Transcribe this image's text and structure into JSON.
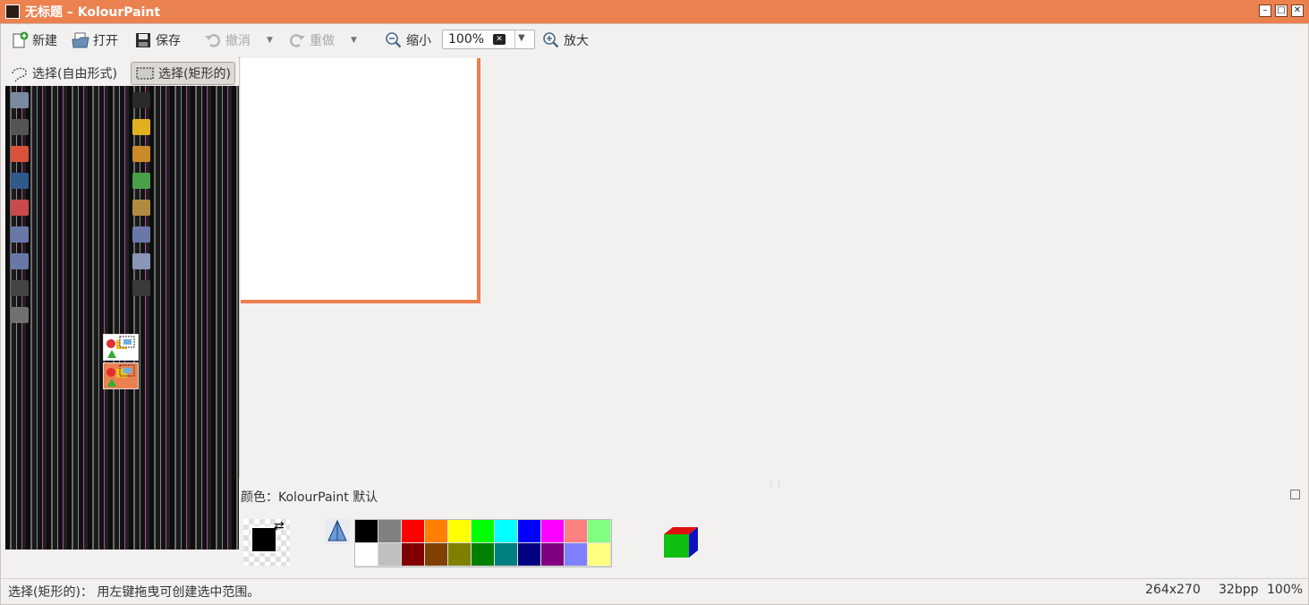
{
  "window": {
    "title": "无标题 – KolourPaint"
  },
  "toolbar": {
    "new_label": "新建",
    "open_label": "打开",
    "save_label": "保存",
    "undo_label": "撤消",
    "redo_label": "重做",
    "zoom_out_label": "缩小",
    "zoom_value": "100%",
    "zoom_in_label": "放大"
  },
  "selection_tools": {
    "free_form_label": "选择(自由形式)",
    "rectangle_label": "选择(矩形的)"
  },
  "palette": {
    "label": "颜色：KolourPaint 默认",
    "colors": [
      "#000000",
      "#808080",
      "#ff0000",
      "#ff8000",
      "#ffff00",
      "#00ff00",
      "#00ffff",
      "#0000ff",
      "#ff00ff",
      "#ff8080",
      "#80ff80",
      "#ffffff",
      "#c0c0c0",
      "#800000",
      "#804000",
      "#808000",
      "#008000",
      "#008080",
      "#000080",
      "#800080",
      "#8080ff",
      "#ffff80"
    ],
    "foreground_color": "#000000"
  },
  "status": {
    "message": "选择(矩形的)：  用左键拖曳可创建选中范围。",
    "dimensions": "264x270",
    "bpp": "32bpp",
    "zoom": "100%"
  },
  "icons": {
    "new": "new-file-icon",
    "open": "open-folder-icon",
    "save": "save-disk-icon",
    "undo": "undo-icon",
    "redo": "redo-icon",
    "zoom_out": "zoom-out-icon",
    "zoom_in": "zoom-in-icon"
  }
}
